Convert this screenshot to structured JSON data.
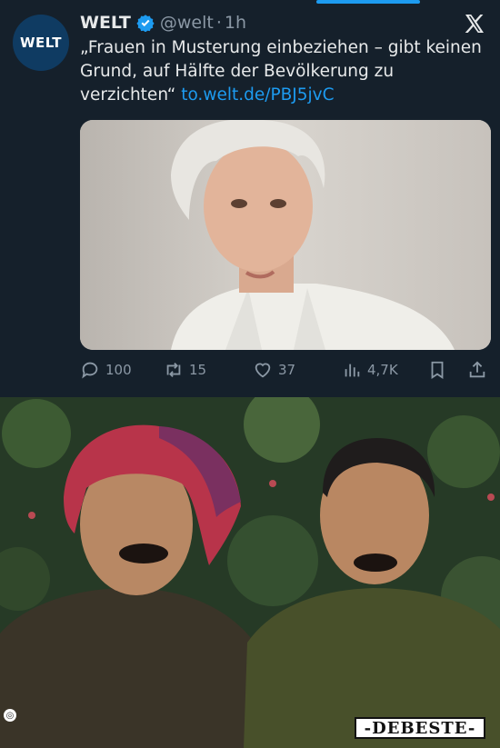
{
  "tweet": {
    "avatar_text": "WELT",
    "name": "WELT",
    "handle": "@welt",
    "dot": "·",
    "time": "1h",
    "text": "„Frauen in Musterung einbeziehen – gibt keinen Grund, auf Hälfte der Bevölkerung zu verzichten“",
    "link": "to.welt.de/PBJ5jvC",
    "actions": {
      "replies": "100",
      "retweets": "15",
      "likes": "37",
      "views": "4,7K"
    },
    "colors": {
      "background": "#15202b",
      "accent": "#1d9bf0",
      "muted": "#8b98a5"
    }
  },
  "bottom_photo": {
    "icons": [
      "lens-icon"
    ]
  },
  "watermark": {
    "text": "-DEBESTE-"
  }
}
